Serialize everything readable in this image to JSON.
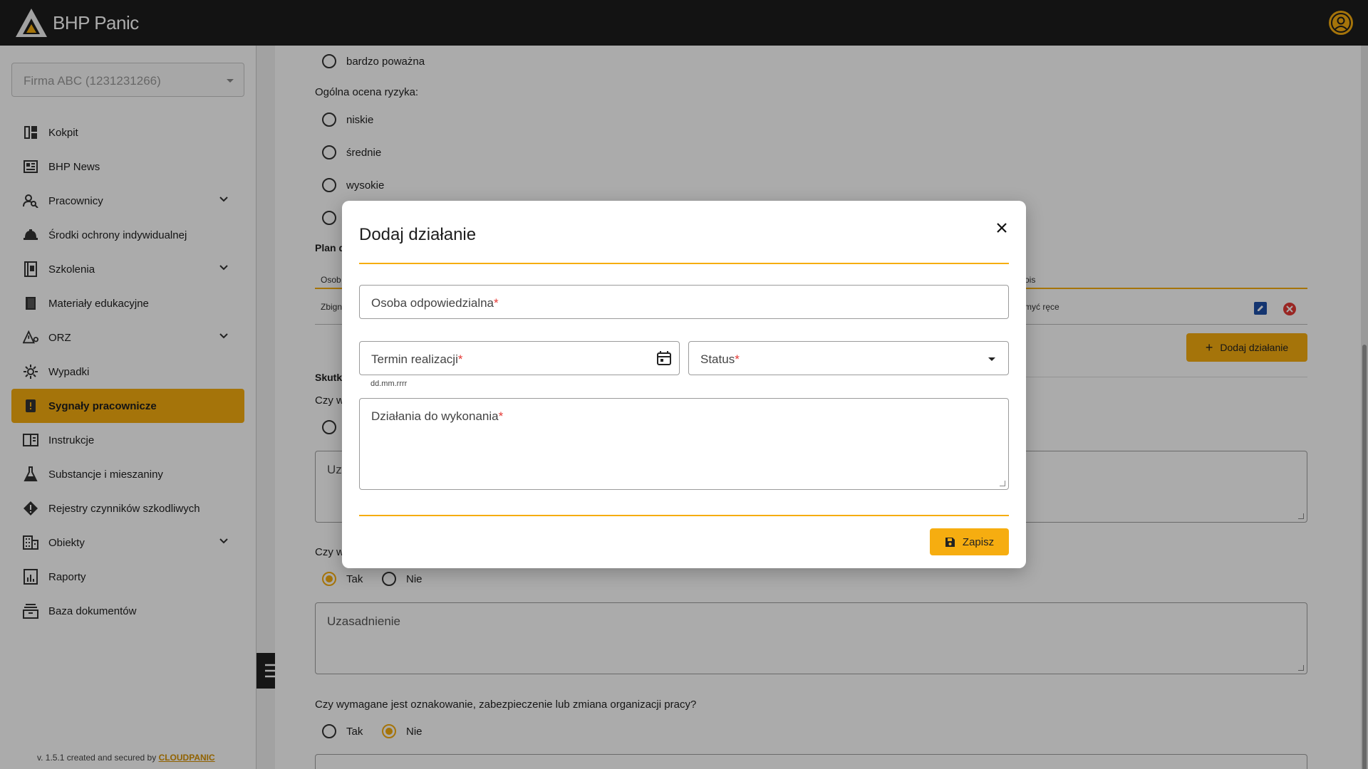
{
  "app": {
    "name": "BHP Panic"
  },
  "sidebar": {
    "company": "Firma ABC (1231231266)",
    "items": [
      {
        "label": "Kokpit",
        "icon": "dashboard-icon",
        "expandable": false
      },
      {
        "label": "BHP News",
        "icon": "newspaper-icon",
        "expandable": false
      },
      {
        "label": "Pracownicy",
        "icon": "person-search-icon",
        "expandable": true
      },
      {
        "label": "Środki ochrony indywidualnej",
        "icon": "helmet-icon",
        "expandable": false
      },
      {
        "label": "Szkolenia",
        "icon": "training-book-icon",
        "expandable": true
      },
      {
        "label": "Materiały edukacyjne",
        "icon": "book-icon",
        "expandable": false
      },
      {
        "label": "ORZ",
        "icon": "risk-warning-icon",
        "expandable": true
      },
      {
        "label": "Wypadki",
        "icon": "accident-icon",
        "expandable": false
      },
      {
        "label": "Sygnały pracownicze",
        "icon": "signal-alert-icon",
        "expandable": false,
        "active": true
      },
      {
        "label": "Instrukcje",
        "icon": "instructions-book-icon",
        "expandable": false
      },
      {
        "label": "Substancje i mieszaniny",
        "icon": "flask-icon",
        "expandable": false
      },
      {
        "label": "Rejestry czynników szkodliwych",
        "icon": "hazard-diamond-icon",
        "expandable": false
      },
      {
        "label": "Obiekty",
        "icon": "building-icon",
        "expandable": true
      },
      {
        "label": "Raporty",
        "icon": "report-chart-icon",
        "expandable": false
      },
      {
        "label": "Baza dokumentów",
        "icon": "archive-icon",
        "expandable": false
      }
    ],
    "version_prefix": "v. 1.5.1 created and secured by",
    "version_brand": "CLOUDPANIC"
  },
  "main": {
    "severity_option_last": "bardzo poważna",
    "risk_label": "Ogólna ocena ryzyka:",
    "risk_options": [
      "niskie",
      "średnie",
      "wysokie"
    ],
    "plan_label_fragment": "Plan d",
    "table_head_left": "Osob",
    "table_head_right": "ois",
    "table_row_left": "Zbign",
    "table_row_right": "myć ręce",
    "add_action_label": "Dodaj działanie",
    "effects_label_fragment": "Skutk",
    "question1_fragment": "Czy w",
    "textarea1_fragment": "Uz",
    "question2_fragment": "Czy w",
    "q2_options": [
      "Tak",
      "Nie"
    ],
    "justification_placeholder": "Uzasadnienie",
    "question3": "Czy wymagane jest oznakowanie, zabezpieczenie lub zmiana organizacji pracy?",
    "q3_options": [
      "Tak",
      "Nie"
    ],
    "colors": {
      "accent": "#f6ad10",
      "topbar": "#1d1d1d"
    }
  },
  "modal": {
    "title": "Dodaj działanie",
    "fields": {
      "responsible": "Osoba odpowiedzialna",
      "deadline": "Termin realizacji",
      "deadline_helper": "dd.mm.rrrr",
      "status": "Status",
      "actions": "Działania do wykonania"
    },
    "required_mark": "*",
    "save_label": "Zapisz"
  }
}
